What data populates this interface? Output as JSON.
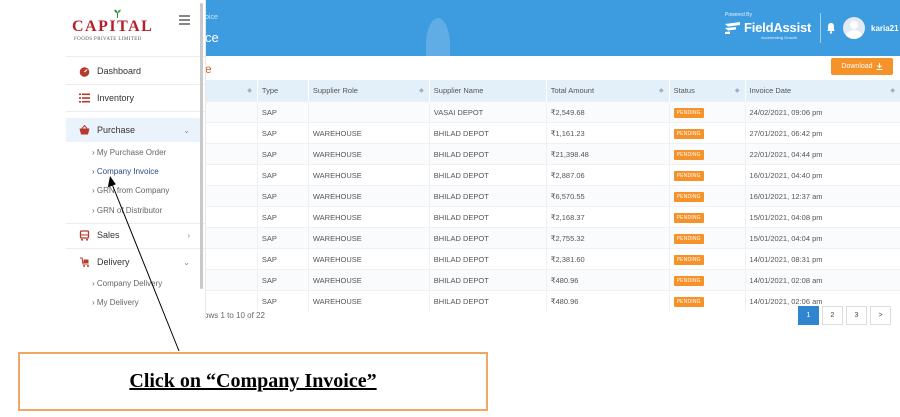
{
  "header": {
    "breadcrumb": "oice",
    "title": "ce",
    "powered_by": "Powered By",
    "brand": "FieldAssist",
    "brand_tagline": "Accelerating Growth",
    "username": "karia21",
    "bell_icon": "bell-icon",
    "color": "#3d9be0"
  },
  "sidebar": {
    "logo_text": "CAPITAL",
    "logo_subtext": "FOODS PRIVATE LIMITED",
    "items": [
      {
        "label": "Dashboard",
        "icon": "dashboard-icon"
      },
      {
        "label": "Inventory",
        "icon": "list-icon"
      },
      {
        "label": "Purchase",
        "icon": "basket-icon"
      },
      {
        "label": "Sales",
        "icon": "cart-icon"
      },
      {
        "label": "Delivery",
        "icon": "delivery-icon"
      }
    ],
    "purchase_subitems": [
      "My Purchase Order",
      "Company Invoice",
      "GRN from Company",
      "GRN of Distributor"
    ],
    "delivery_subitems": [
      "Company Delivery",
      "My Delivery"
    ]
  },
  "main": {
    "heading": "e",
    "download_label": "Download",
    "table": {
      "columns": [
        "",
        "Type",
        "Supplier Role",
        "Supplier Name",
        "Total Amount",
        "Status",
        "Invoice Date"
      ],
      "rows": [
        [
          "",
          "SAP",
          "",
          "VASAI DEPOT",
          "₹2,549.68",
          "PENDING",
          "24/02/2021, 09:06 pm"
        ],
        [
          "",
          "SAP",
          "WAREHOUSE",
          "BHILAD DEPOT",
          "₹1,161.23",
          "PENDING",
          "27/01/2021, 06:42 pm"
        ],
        [
          "",
          "SAP",
          "WAREHOUSE",
          "BHILAD DEPOT",
          "₹21,398.48",
          "PENDING",
          "22/01/2021, 04:44 pm"
        ],
        [
          "",
          "SAP",
          "WAREHOUSE",
          "BHILAD DEPOT",
          "₹2,887.06",
          "PENDING",
          "16/01/2021, 04:40 pm"
        ],
        [
          "",
          "SAP",
          "WAREHOUSE",
          "BHILAD DEPOT",
          "₹6,570.55",
          "PENDING",
          "16/01/2021, 12:37 am"
        ],
        [
          "",
          "SAP",
          "WAREHOUSE",
          "BHILAD DEPOT",
          "₹2,168.37",
          "PENDING",
          "15/01/2021, 04:08 pm"
        ],
        [
          "",
          "SAP",
          "WAREHOUSE",
          "BHILAD DEPOT",
          "₹2,755.32",
          "PENDING",
          "15/01/2021, 04:04 pm"
        ],
        [
          "",
          "SAP",
          "WAREHOUSE",
          "BHILAD DEPOT",
          "₹2,381.60",
          "PENDING",
          "14/01/2021, 08:31 pm"
        ],
        [
          "",
          "SAP",
          "WAREHOUSE",
          "BHILAD DEPOT",
          "₹480.96",
          "PENDING",
          "14/01/2021, 02:08 am"
        ],
        [
          "",
          "SAP",
          "WAREHOUSE",
          "BHILAD DEPOT",
          "₹480.96",
          "PENDING",
          "14/01/2021, 02:06 am"
        ]
      ]
    },
    "showing_text": "ows 1 to 10 of 22",
    "pagination": [
      "1",
      "2",
      "3",
      ">"
    ]
  },
  "callout": {
    "text": "Click on “Company Invoice”"
  },
  "colors": {
    "accent": "#f5922a",
    "brand_red": "#b51f2a",
    "callout_border": "#f0a765"
  }
}
